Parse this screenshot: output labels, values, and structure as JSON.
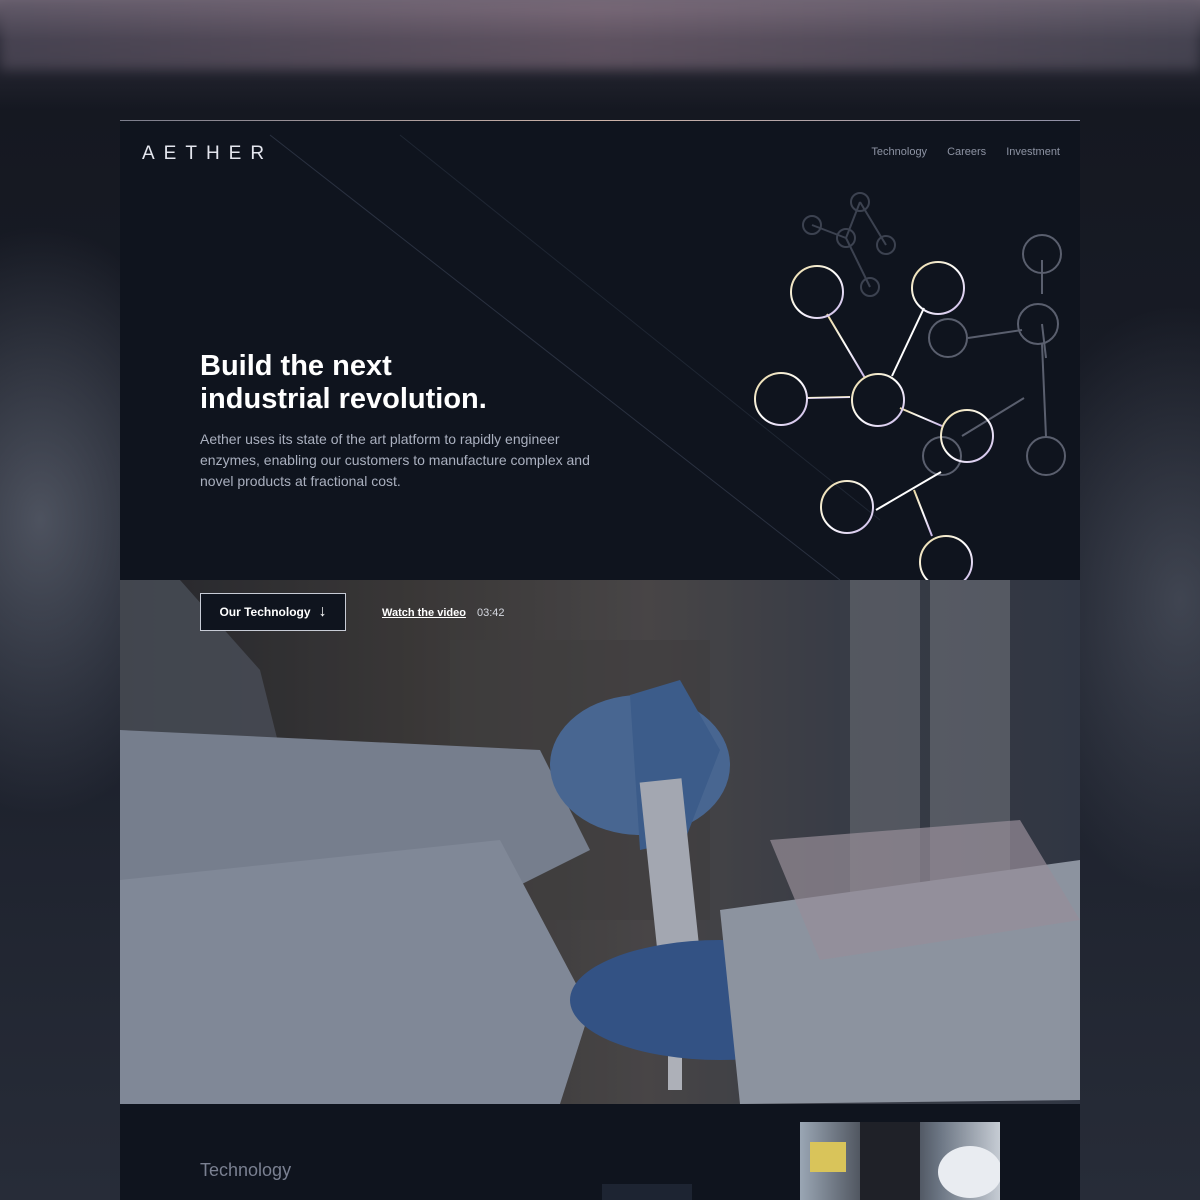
{
  "brand": {
    "logo": "AETHER"
  },
  "nav": {
    "items": [
      "Technology",
      "Careers",
      "Investment"
    ]
  },
  "hero": {
    "title_line1": "Build the next",
    "title_line2": "industrial revolution.",
    "body": "Aether uses its state of the art platform to rapidly engineer enzymes, enabling our customers to manufacture complex and novel products at fractional cost."
  },
  "cta": {
    "primary_label": "Our Technology",
    "primary_icon": "arrow-down-icon",
    "video_link_label": "Watch the video",
    "video_duration": "03:42"
  },
  "section": {
    "label": "Technology"
  },
  "colors": {
    "page_bg": "#0f141e",
    "text_primary": "#ffffff",
    "text_muted": "#aab0bf",
    "nav_text": "#8d93a3",
    "molecule_gradient": [
      "#e8d6a0",
      "#ffffff",
      "#c7b3e6"
    ]
  }
}
